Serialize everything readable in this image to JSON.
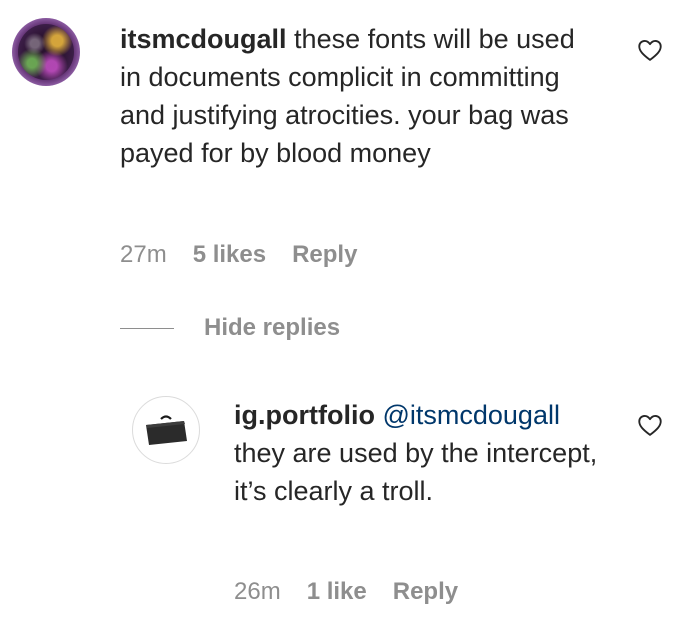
{
  "comment": {
    "username": "itsmcdougall",
    "text": "these fonts will be used in documents complicit in committing and justifying atrocities. your bag was payed for by blood money",
    "time": "27m",
    "likes": "5 likes",
    "reply_label": "Reply"
  },
  "replies_toggle": {
    "label": "Hide replies"
  },
  "reply": {
    "username": "ig.portfolio",
    "mention": "@itsmcdougall",
    "text": "they are used by the intercept, it’s clearly a troll.",
    "time": "26m",
    "likes": "1 like",
    "reply_label": "Reply"
  },
  "icons": {
    "like": "heart-icon",
    "portfolio_avatar": "portfolio-icon"
  },
  "colors": {
    "text": "#262626",
    "muted": "#8e8e8e",
    "mention": "#00376b",
    "divider": "#dbdbdb"
  }
}
